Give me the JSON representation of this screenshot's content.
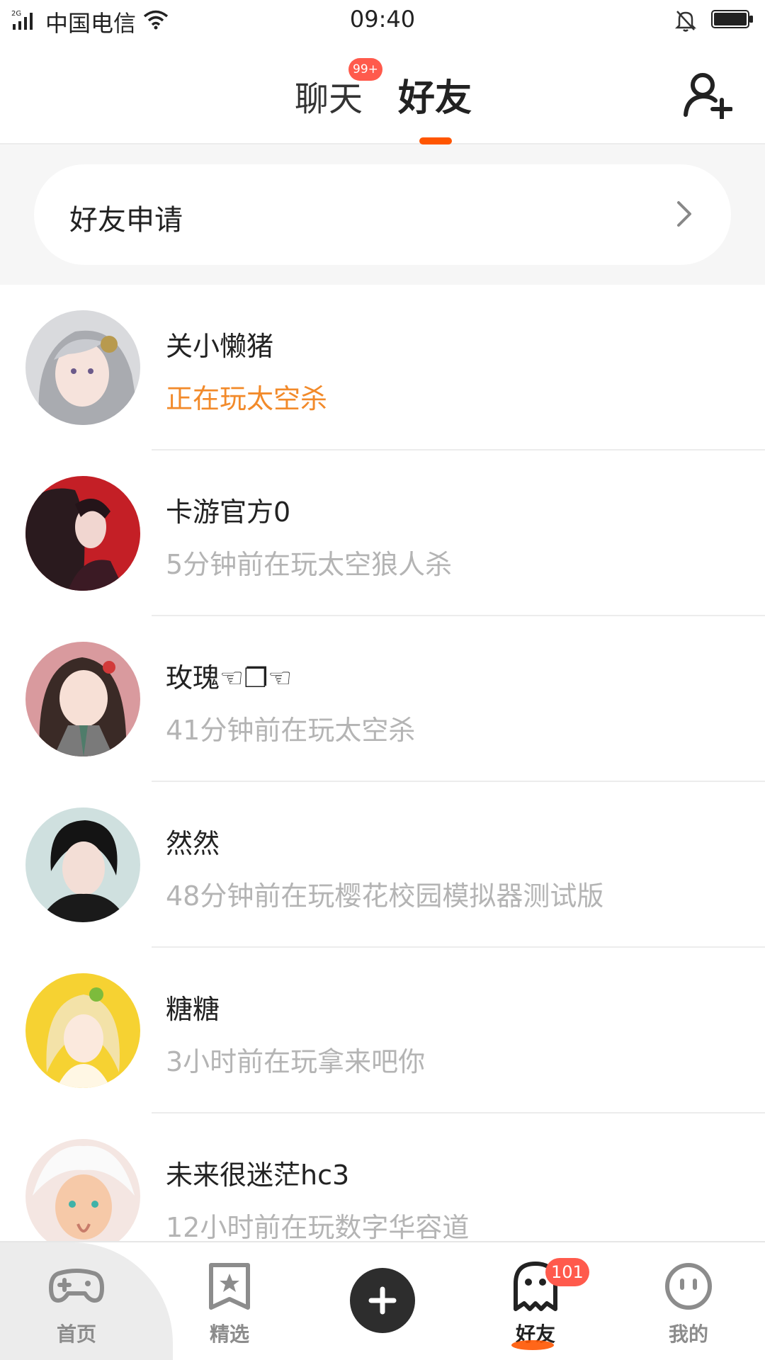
{
  "status_bar": {
    "network": "2G",
    "carrier": "中国电信",
    "time": "09:40"
  },
  "header": {
    "tabs": [
      {
        "label": "聊天",
        "badge": "99+"
      },
      {
        "label": "好友",
        "active": true
      }
    ],
    "add_friend_icon": "add-user-icon"
  },
  "friend_request": {
    "label": "好友申请"
  },
  "friends": [
    {
      "name": "关小懒猪",
      "status": "正在玩太空杀",
      "active": true
    },
    {
      "name": "卡游官方0",
      "status": "5分钟前在玩太空狼人杀"
    },
    {
      "name": "玫瑰☜❐☜",
      "status": "41分钟前在玩太空杀"
    },
    {
      "name": "然然",
      "status": "48分钟前在玩樱花校园模拟器测试版"
    },
    {
      "name": "糖糖",
      "status": "3小时前在玩拿来吧你"
    },
    {
      "name": "未来很迷茫hc3",
      "status": "12小时前在玩数字华容道"
    }
  ],
  "bottom_nav": {
    "items": [
      {
        "label": "首页",
        "icon": "gamepad-icon"
      },
      {
        "label": "精选",
        "icon": "star-bookmark-icon"
      },
      {
        "label": "",
        "icon": "plus-icon"
      },
      {
        "label": "好友",
        "icon": "ghost-icon",
        "badge": "101",
        "active": true
      },
      {
        "label": "我的",
        "icon": "face-icon"
      }
    ]
  },
  "colors": {
    "accent": "#ff5500",
    "active_status": "#f28a2a",
    "badge": "#ff5a4c",
    "muted_text": "#b4b4b4"
  }
}
